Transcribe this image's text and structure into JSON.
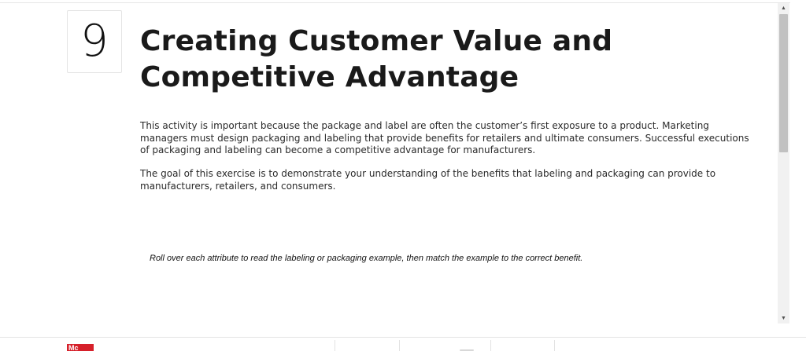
{
  "chapter": {
    "number": "9"
  },
  "title": "Creating Customer Value and Competitive Advantage",
  "paragraphs": [
    "This activity is important because the package and label are often the customer’s first exposure to a product. Marketing managers must design packaging and labeling that provide benefits for retailers and ultimate consumers. Successful executions of packaging and labeling can become a competitive advantage for manufacturers.",
    "The goal of this exercise is to demonstrate your understanding of the benefits that labeling and packaging can provide to manufacturers, retailers, and consumers."
  ],
  "instruction": "Roll over each attribute to read the labeling or packaging example, then match the example to the correct benefit.",
  "scrollbar": {
    "up_glyph": "▲",
    "down_glyph": "▼"
  },
  "footer": {
    "logo_text": "Mc"
  },
  "colors": {
    "brand_red": "#d6202a"
  }
}
